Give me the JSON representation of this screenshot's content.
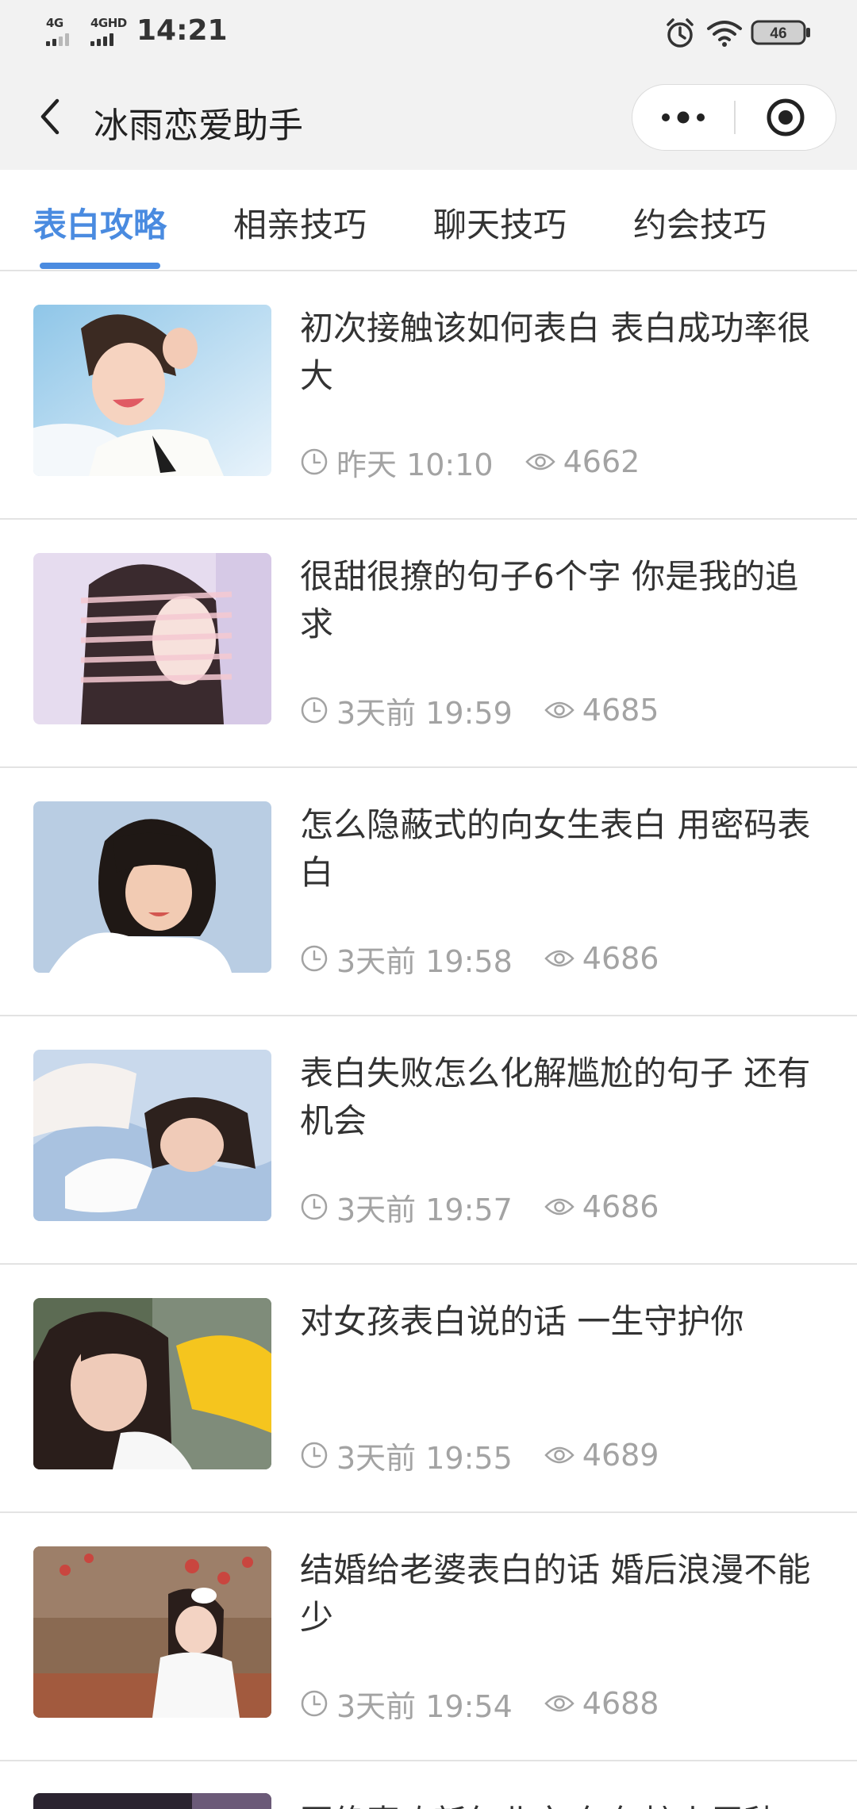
{
  "status_bar": {
    "network_1": "4G",
    "network_2": "4GHD",
    "time": "14:21",
    "battery": "46",
    "icons": [
      "alarm-icon",
      "wifi-icon",
      "battery-icon"
    ]
  },
  "nav": {
    "back_icon": "chevron-left-icon",
    "title": "冰雨恋爱助手",
    "more_icon": "more-dots-icon",
    "close_icon": "target-circle-icon"
  },
  "colors": {
    "accent": "#4a8be0",
    "meta_text": "#a3a3a3",
    "divider": "#e3e3e3",
    "header_bg": "#f2f2f2"
  },
  "tabs": [
    {
      "label": "表白攻略",
      "active": true
    },
    {
      "label": "相亲技巧",
      "active": false
    },
    {
      "label": "聊天技巧",
      "active": false
    },
    {
      "label": "约会技巧",
      "active": false
    }
  ],
  "articles": [
    {
      "title": "初次接触该如何表白 表白成功率很大",
      "time": "昨天 10:10",
      "views": "4662",
      "image": "photo-girl-sky-background"
    },
    {
      "title": "很甜很撩的句子6个字 你是我的追求",
      "time": "3天前 19:59",
      "views": "4685",
      "image": "photo-girl-light-stripes"
    },
    {
      "title": "怎么隐蔽式的向女生表白 用密码表白",
      "time": "3天前 19:58",
      "views": "4686",
      "image": "photo-girl-bob-hair-winking"
    },
    {
      "title": "表白失败怎么化解尴尬的句子 还有机会",
      "time": "3天前 19:57",
      "views": "4686",
      "image": "photo-girl-lying-tulle"
    },
    {
      "title": "对女孩表白说的话 一生守护你",
      "time": "3天前 19:55",
      "views": "4689",
      "image": "photo-girl-yellow-hat"
    },
    {
      "title": "结婚给老婆表白的话 婚后浪漫不能少",
      "time": "3天前 19:54",
      "views": "4688",
      "image": "photo-girl-flowers-garden"
    }
  ],
  "partial_article": {
    "title": "回绝喜欢新年北京 年年接上尾秋",
    "image": "photo-dark-partial"
  }
}
